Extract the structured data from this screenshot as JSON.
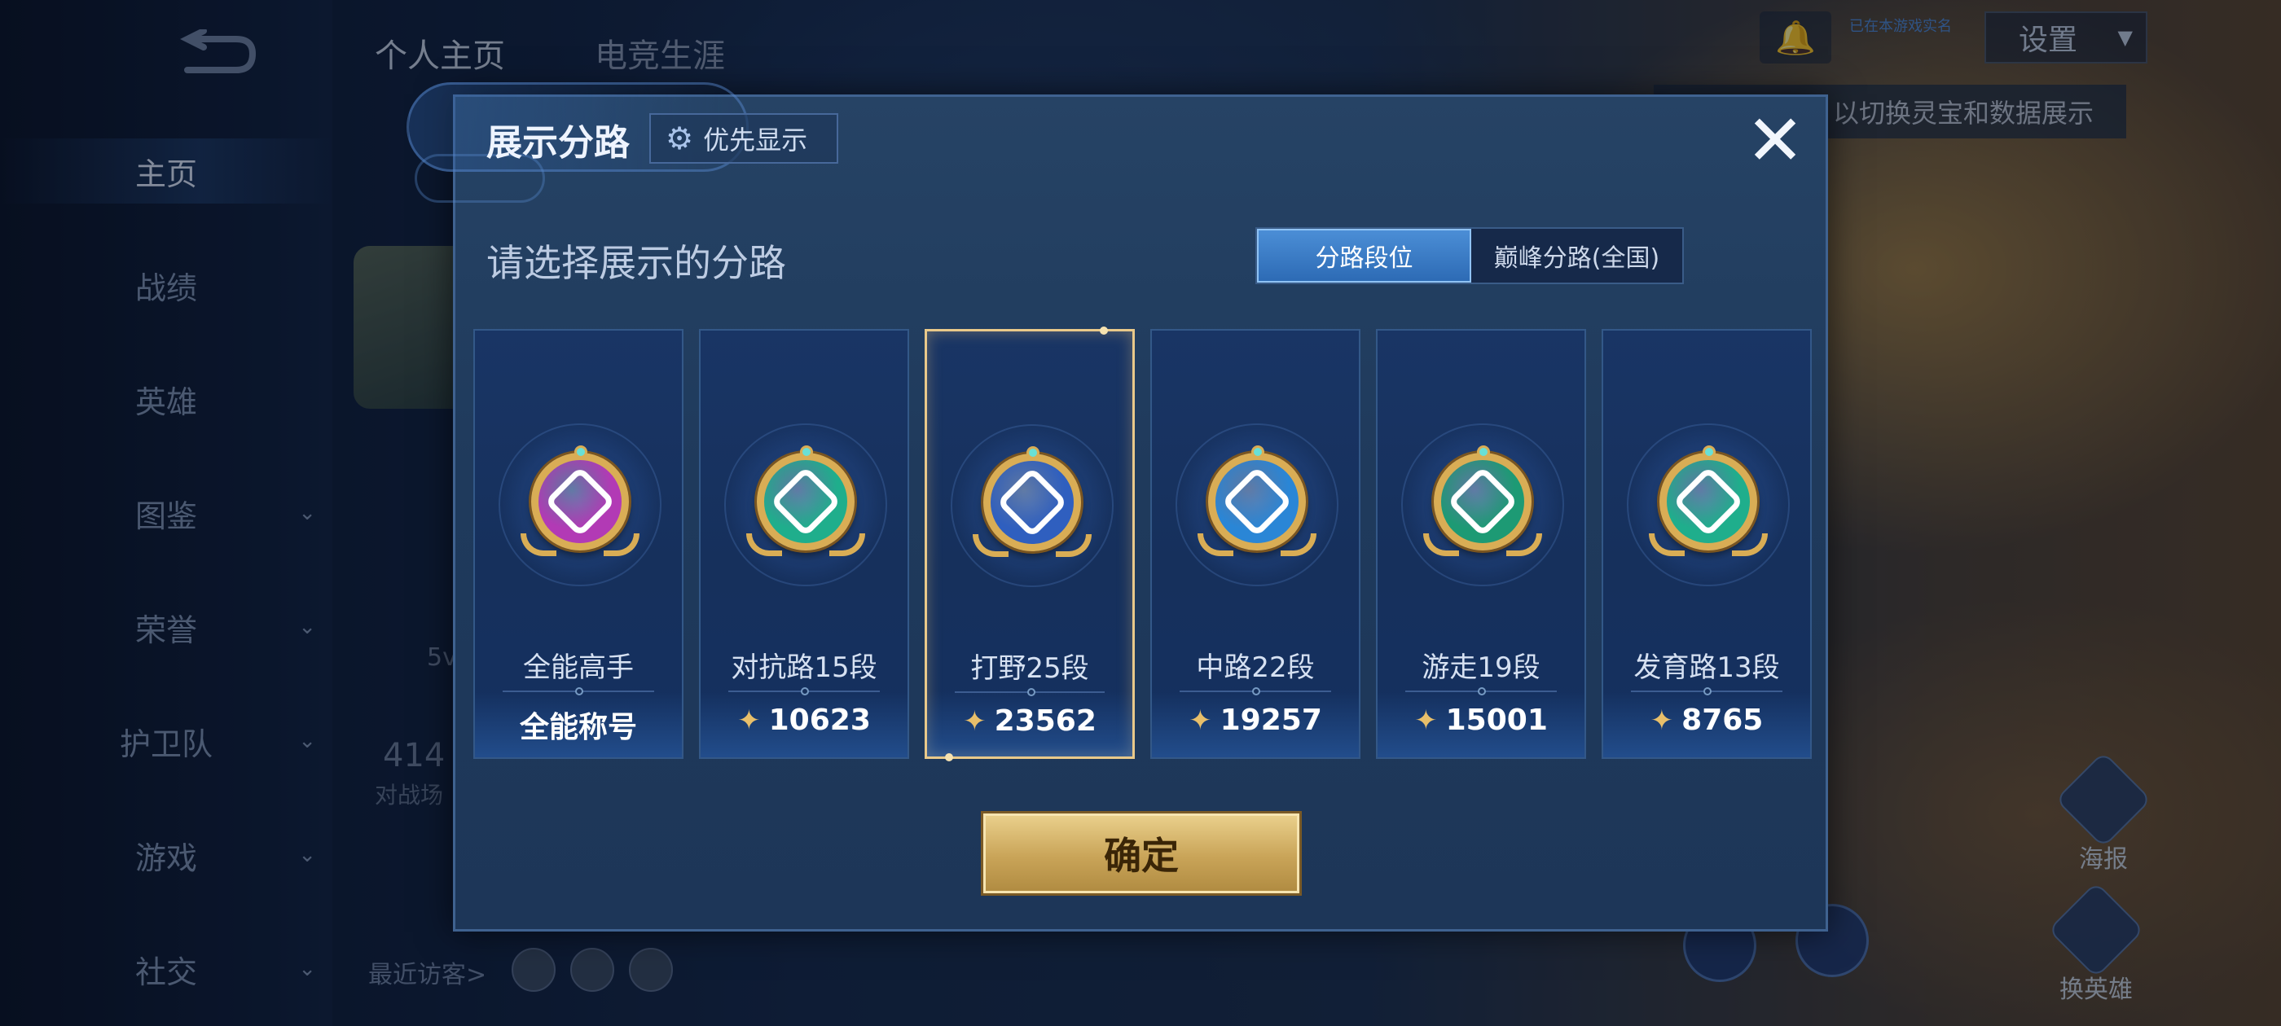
{
  "background": {
    "nav": [
      {
        "label": "主页",
        "active": true,
        "chevron": false
      },
      {
        "label": "战绩",
        "active": false,
        "chevron": false
      },
      {
        "label": "英雄",
        "active": false,
        "chevron": false
      },
      {
        "label": "图鉴",
        "active": false,
        "chevron": true
      },
      {
        "label": "荣誉",
        "active": false,
        "chevron": true
      },
      {
        "label": "护卫队",
        "active": false,
        "chevron": true
      },
      {
        "label": "游戏",
        "active": false,
        "chevron": true
      },
      {
        "label": "社交",
        "active": false,
        "chevron": true
      }
    ],
    "top_tabs": [
      "个人主页",
      "电竞生涯"
    ],
    "settings_label": "设置",
    "tip_small": "已在本游戏实名",
    "hint_text": "以切换灵宝和数据展示",
    "visitors_label": "最近访客>",
    "stat_faint": "414",
    "stat_faint_sub": "对战场",
    "stat_faint_2": "5v",
    "right_icons": [
      "海报",
      "换英雄"
    ]
  },
  "dialog": {
    "title": "展示分路",
    "priority_label": "优先显示",
    "close_icon": "close-x",
    "subtitle": "请选择展示的分路",
    "toggle": {
      "options": [
        "分路段位",
        "巅峰分路(全国)"
      ],
      "selected": 0
    },
    "cards": [
      {
        "name": "全能高手",
        "value": "全能称号",
        "show_score_icon": false,
        "emblem_color": "#b23ab5",
        "emblem": "all-round-emblem",
        "selected": false
      },
      {
        "name": "对抗路15段",
        "value": "10623",
        "show_score_icon": true,
        "emblem_color": "#1fae8c",
        "emblem": "clash-lane-emblem",
        "selected": false
      },
      {
        "name": "打野25段",
        "value": "23562",
        "show_score_icon": true,
        "emblem_color": "#2f5fbf",
        "emblem": "jungle-dragon-emblem",
        "selected": true
      },
      {
        "name": "中路22段",
        "value": "19257",
        "show_score_icon": true,
        "emblem_color": "#2a86d6",
        "emblem": "mid-lane-emblem",
        "selected": false
      },
      {
        "name": "游走19段",
        "value": "15001",
        "show_score_icon": true,
        "emblem_color": "#1d9a74",
        "emblem": "roam-emblem",
        "selected": false
      },
      {
        "name": "发育路13段",
        "value": "8765",
        "show_score_icon": true,
        "emblem_color": "#1fae8c",
        "emblem": "farm-lane-emblem",
        "selected": false
      }
    ],
    "confirm_label": "确定"
  }
}
